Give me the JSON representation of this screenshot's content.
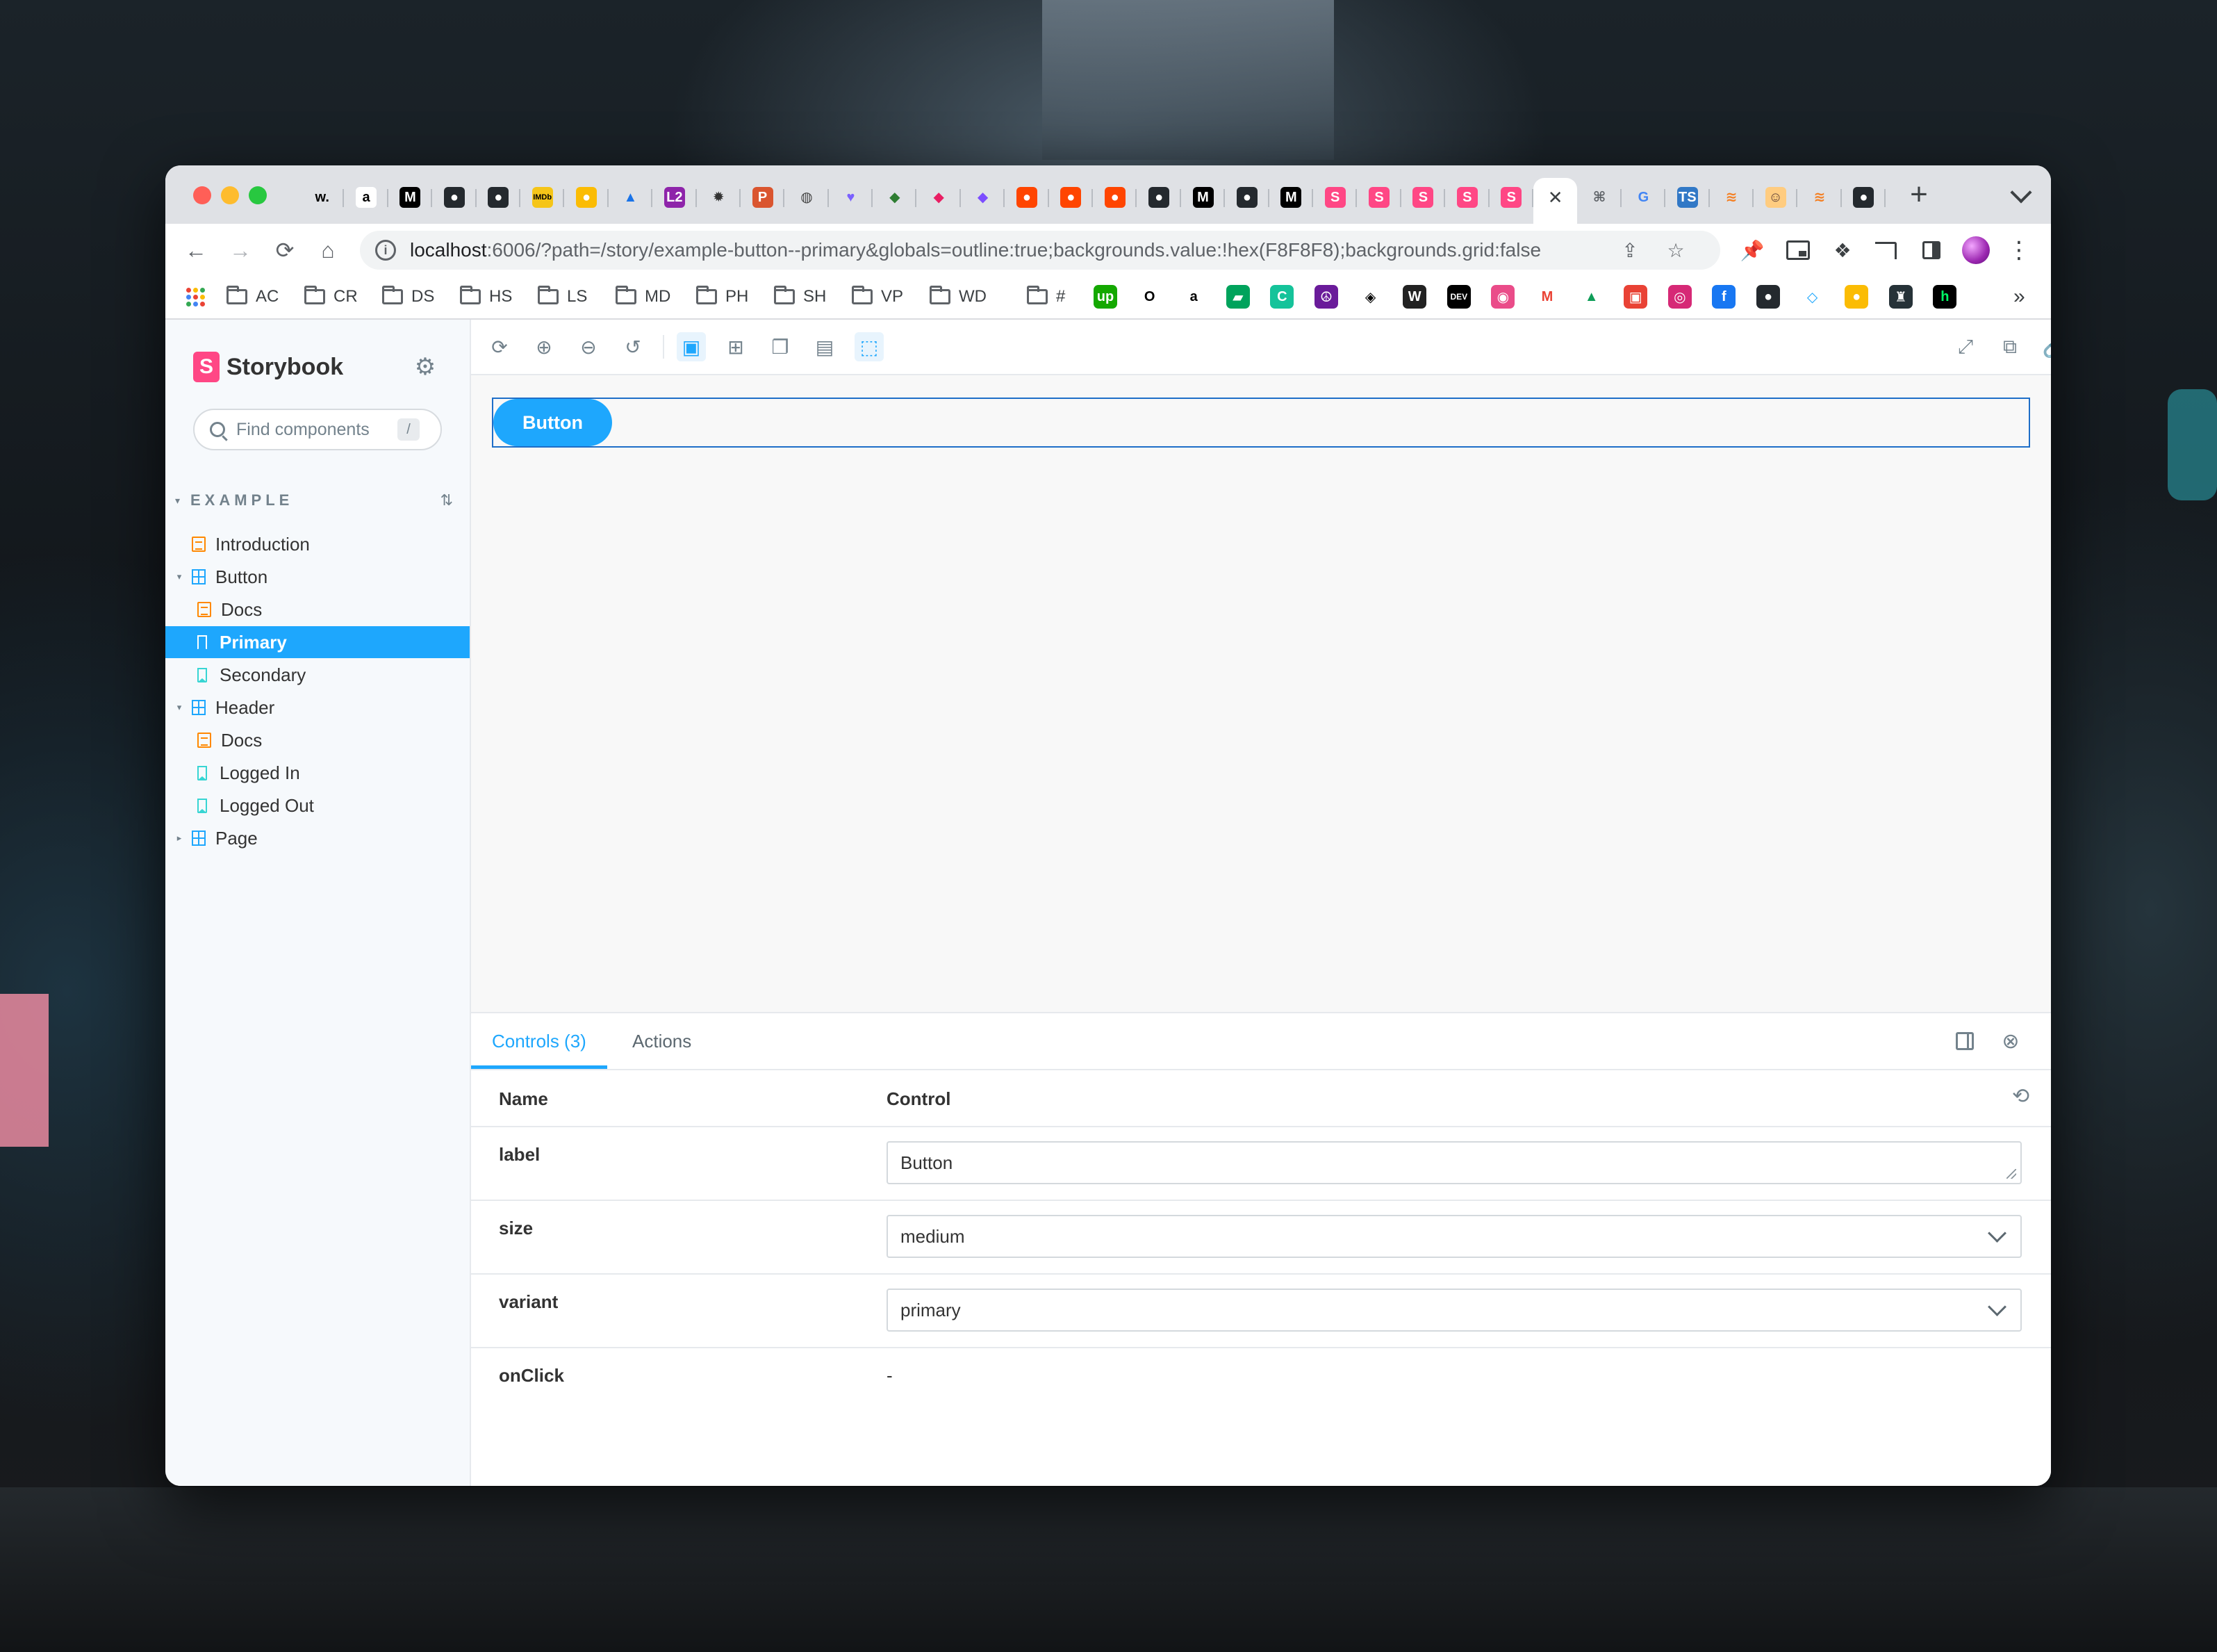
{
  "browser": {
    "url_host": "localhost",
    "url_rest": ":6006/?path=/story/example-button--primary&globals=outline:true;backgrounds.value:!hex(F8F8F8);backgrounds.grid:false",
    "tab_close_glyph": "✕",
    "new_tab_glyph": "+",
    "tab_list_glyph": "⌄",
    "bookmark_folders": [
      "AC",
      "CR",
      "DS",
      "HS",
      "LS",
      "MD",
      "PH",
      "SH",
      "VP",
      "WD"
    ],
    "bookmark_hash": "#",
    "bookmark_more": "»",
    "tabs": [
      {
        "glyph": "w.",
        "color": "#000000",
        "bg": "transparent"
      },
      {
        "glyph": "a",
        "color": "#000000",
        "bg": "#ffffff"
      },
      {
        "glyph": "M",
        "color": "#ffffff",
        "bg": "#000000"
      },
      {
        "glyph": "●",
        "color": "#ffffff",
        "bg": "#24292e"
      },
      {
        "glyph": "●",
        "color": "#ffffff",
        "bg": "#24292e"
      },
      {
        "glyph": "IMDb",
        "color": "#000000",
        "bg": "#f5c518"
      },
      {
        "glyph": "●",
        "color": "#ffffff",
        "bg": "#fbbc04"
      },
      {
        "glyph": "▲",
        "color": "#1a73e8",
        "bg": "transparent"
      },
      {
        "glyph": "L2",
        "color": "#ffffff",
        "bg": "#8e24aa"
      },
      {
        "glyph": "✹",
        "color": "#333333",
        "bg": "transparent"
      },
      {
        "glyph": "P",
        "color": "#ffffff",
        "bg": "#da552f"
      },
      {
        "glyph": "◍",
        "color": "#444444",
        "bg": "transparent"
      },
      {
        "glyph": "♥",
        "color": "#7b61ff",
        "bg": "transparent"
      },
      {
        "glyph": "◆",
        "color": "#2e7d32",
        "bg": "transparent"
      },
      {
        "glyph": "◆",
        "color": "#e91e63",
        "bg": "transparent"
      },
      {
        "glyph": "◆",
        "color": "#7c4dff",
        "bg": "transparent"
      },
      {
        "glyph": "●",
        "color": "#ffffff",
        "bg": "#ff4500"
      },
      {
        "glyph": "●",
        "color": "#ffffff",
        "bg": "#ff4500"
      },
      {
        "glyph": "●",
        "color": "#ffffff",
        "bg": "#ff4500"
      },
      {
        "glyph": "●",
        "color": "#ffffff",
        "bg": "#24292e"
      },
      {
        "glyph": "M",
        "color": "#ffffff",
        "bg": "#000000"
      },
      {
        "glyph": "●",
        "color": "#ffffff",
        "bg": "#24292e"
      },
      {
        "glyph": "M",
        "color": "#ffffff",
        "bg": "#000000"
      },
      {
        "glyph": "S",
        "color": "#ffffff",
        "bg": "#ff4785"
      },
      {
        "glyph": "S",
        "color": "#ffffff",
        "bg": "#ff4785"
      },
      {
        "glyph": "S",
        "color": "#ffffff",
        "bg": "#ff4785"
      },
      {
        "glyph": "S",
        "color": "#ffffff",
        "bg": "#ff4785"
      },
      {
        "glyph": "S",
        "color": "#ffffff",
        "bg": "#ff4785"
      }
    ],
    "tabs_after_active": [
      {
        "glyph": "⌘",
        "color": "#5f6368",
        "bg": "transparent"
      },
      {
        "glyph": "G",
        "color": "#4285f4",
        "bg": "transparent"
      },
      {
        "glyph": "TS",
        "color": "#ffffff",
        "bg": "#3178c6"
      },
      {
        "glyph": "≋",
        "color": "#f48024",
        "bg": "transparent"
      },
      {
        "glyph": "☺",
        "color": "#5d4037",
        "bg": "#ffcc80"
      },
      {
        "glyph": "≋",
        "color": "#f48024",
        "bg": "transparent"
      },
      {
        "glyph": "●",
        "color": "#ffffff",
        "bg": "#24292e"
      }
    ],
    "bookmark_icons": [
      {
        "glyph": "up",
        "color": "#ffffff",
        "bg": "#14a800"
      },
      {
        "glyph": "O",
        "color": "#000000",
        "bg": "transparent"
      },
      {
        "glyph": "a",
        "color": "#000000",
        "bg": "transparent"
      },
      {
        "glyph": "▰",
        "color": "#ffffff",
        "bg": "#00a35c"
      },
      {
        "glyph": "C",
        "color": "#ffffff",
        "bg": "#15c39a"
      },
      {
        "glyph": "☮",
        "color": "#ffffff",
        "bg": "#6a1b9a"
      },
      {
        "glyph": "◈",
        "color": "#000000",
        "bg": "transparent"
      },
      {
        "glyph": "W",
        "color": "#ffffff",
        "bg": "#222222"
      },
      {
        "glyph": "DEV",
        "color": "#ffffff",
        "bg": "#000000"
      },
      {
        "glyph": "◉",
        "color": "#ffffff",
        "bg": "#ea4c89"
      },
      {
        "glyph": "M",
        "color": "#ea4335",
        "bg": "transparent"
      },
      {
        "glyph": "▲",
        "color": "#0f9d58",
        "bg": "transparent"
      },
      {
        "glyph": "▣",
        "color": "#ffffff",
        "bg": "#e94235"
      },
      {
        "glyph": "◎",
        "color": "#ffffff",
        "bg": "#d62976"
      },
      {
        "glyph": "f",
        "color": "#ffffff",
        "bg": "#1877f2"
      },
      {
        "glyph": "●",
        "color": "#ffffff",
        "bg": "#24292e"
      },
      {
        "glyph": "◇",
        "color": "#1ea7fd",
        "bg": "transparent"
      },
      {
        "glyph": "●",
        "color": "#ffffff",
        "bg": "#fbbc04"
      },
      {
        "glyph": "♜",
        "color": "#ffffff",
        "bg": "#263238"
      },
      {
        "glyph": "h",
        "color": "#00ff66",
        "bg": "#000000"
      }
    ]
  },
  "storybook": {
    "brand": "Storybook",
    "brand_mark": "S",
    "search_placeholder": "Find components",
    "search_shortcut": "/",
    "section_title": "EXAMPLE",
    "tree": [
      {
        "label": "Introduction",
        "kind": "doc",
        "level": 0,
        "caret": "",
        "selected": false
      },
      {
        "label": "Button",
        "kind": "component",
        "level": 0,
        "caret": "▾",
        "selected": false
      },
      {
        "label": "Docs",
        "kind": "doc",
        "level": 1,
        "caret": "",
        "selected": false
      },
      {
        "label": "Primary",
        "kind": "story",
        "level": 1,
        "caret": "",
        "selected": true
      },
      {
        "label": "Secondary",
        "kind": "story",
        "level": 1,
        "caret": "",
        "selected": false
      },
      {
        "label": "Header",
        "kind": "component",
        "level": 0,
        "caret": "▾",
        "selected": false
      },
      {
        "label": "Docs",
        "kind": "doc",
        "level": 1,
        "caret": "",
        "selected": false
      },
      {
        "label": "Logged In",
        "kind": "story",
        "level": 1,
        "caret": "",
        "selected": false
      },
      {
        "label": "Logged Out",
        "kind": "story",
        "level": 1,
        "caret": "",
        "selected": false
      },
      {
        "label": "Page",
        "kind": "component",
        "level": 0,
        "caret": "▸",
        "selected": false
      }
    ],
    "preview_button_label": "Button",
    "addon_tabs": [
      "Controls (3)",
      "Actions"
    ],
    "controls_header": {
      "name": "Name",
      "control": "Control"
    },
    "controls": {
      "label": {
        "name": "label",
        "value": "Button"
      },
      "size": {
        "name": "size",
        "value": "medium"
      },
      "variant": {
        "name": "variant",
        "value": "primary"
      },
      "onClick": {
        "name": "onClick",
        "value": "-"
      }
    }
  },
  "colors": {
    "storybook_accent": "#1ea7fd",
    "storybook_brand": "#ff4785",
    "traffic_red": "#ff5f57",
    "traffic_yellow": "#febc2e",
    "traffic_green": "#28c840"
  }
}
